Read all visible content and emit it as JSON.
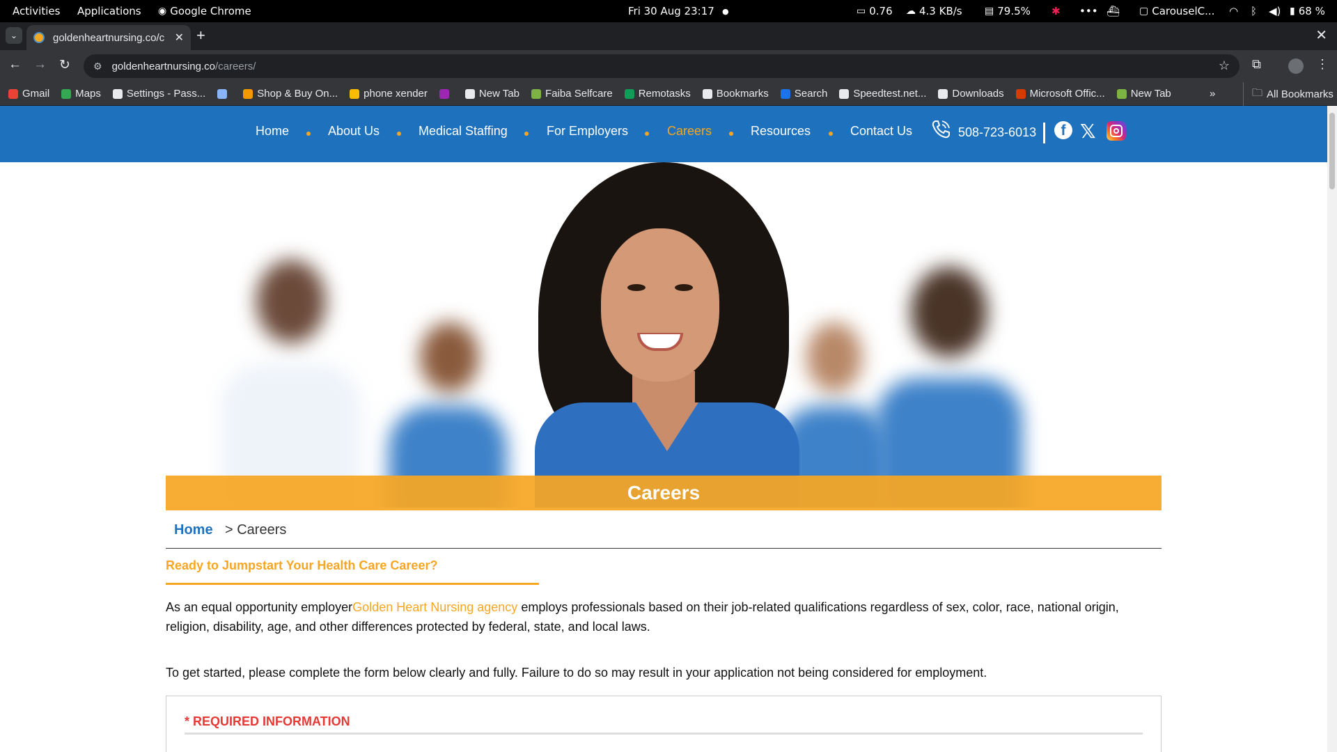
{
  "system_bar": {
    "activities": "Activities",
    "applications": "Applications",
    "active_app": "Google Chrome",
    "datetime": "Fri 30 Aug  23:17",
    "dot": "●",
    "cpu": "0.76",
    "net": "4.3 KB/s",
    "mem": "79.5%",
    "dots": "•••",
    "clipboard": "CarouselC...",
    "battery": "68 %"
  },
  "browser": {
    "tab_title": "goldenheartnursing.co/c",
    "tab_close": "✕",
    "new_tab": "+",
    "window_close": "✕",
    "url_host": "goldenheartnursing.co",
    "url_path": "/careers/",
    "bookmarks": [
      {
        "label": "Gmail",
        "color": "#ea4335"
      },
      {
        "label": "Maps",
        "color": "#34a853"
      },
      {
        "label": "Settings - Pass...",
        "color": "#e8eaed"
      },
      {
        "label": "",
        "color": "#8ab4f8"
      },
      {
        "label": "Shop & Buy On...",
        "color": "#f29900"
      },
      {
        "label": "phone xender",
        "color": "#fbbc04"
      },
      {
        "label": "",
        "color": "#9c27b0"
      },
      {
        "label": "New Tab",
        "color": "#e8eaed"
      },
      {
        "label": "Faiba Selfcare",
        "color": "#7cb342"
      },
      {
        "label": "Remotasks",
        "color": "#0f9d58"
      },
      {
        "label": "Bookmarks",
        "color": "#e8eaed"
      },
      {
        "label": "Search",
        "color": "#1a73e8"
      },
      {
        "label": "Speedtest.net...",
        "color": "#e8eaed"
      },
      {
        "label": "Downloads",
        "color": "#e8eaed"
      },
      {
        "label": "Microsoft Offic...",
        "color": "#d83b01"
      },
      {
        "label": "New Tab",
        "color": "#7cb342"
      }
    ],
    "bookmarks_more": "»",
    "all_bookmarks": "All Bookmarks"
  },
  "site": {
    "nav": {
      "items": [
        "Home",
        "About Us",
        "Medical Staffing",
        "For Employers",
        "Careers",
        "Resources",
        "Contact Us"
      ],
      "active": "Careers",
      "phone": "508-723-6013"
    },
    "banner_title": "Careers",
    "breadcrumb": {
      "home": "Home",
      "current": "> Careers"
    },
    "subheading": "Ready to Jumpstart Your Health Care Career?",
    "para1_before": "As an equal opportunity employer",
    "para1_link": "Golden Heart Nursing agency",
    "para1_after": " employs professionals based on their job-related qualifications regardless of sex, color, race, national origin, religion, disability, age, and other differences protected by federal, state, and local laws.",
    "para2": "To get started, please complete the form below clearly and fully. Failure to do so may result in your application not being considered for employment.",
    "required_info": "* REQUIRED INFORMATION"
  },
  "colors": {
    "nav_blue": "#1e72bd",
    "accent_orange": "#f6a623",
    "required_red": "#e53935"
  }
}
